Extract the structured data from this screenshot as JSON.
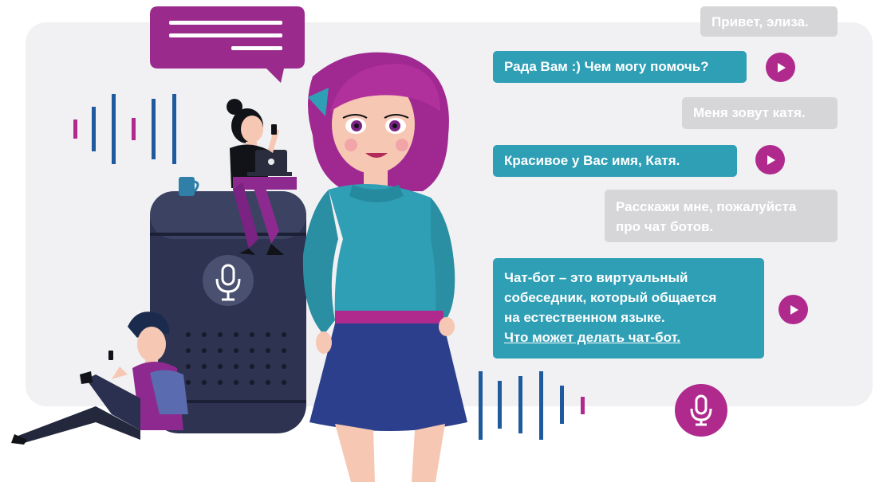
{
  "chat": {
    "messages": [
      {
        "role": "user",
        "lines": [
          "Привет, элиза."
        ]
      },
      {
        "role": "bot",
        "lines": [
          "Рада Вам :) Чем могу помочь?"
        ]
      },
      {
        "role": "user",
        "lines": [
          "Меня зовут катя."
        ]
      },
      {
        "role": "bot",
        "lines": [
          "Красивое у Вас имя, Катя."
        ]
      },
      {
        "role": "user",
        "lines": [
          "Расскажи мне, пожалуйста",
          "про чат ботов."
        ]
      },
      {
        "role": "bot",
        "lines": [
          "Чат-бот – это виртуальный",
          "собеседник, который общается",
          "на естественном языке."
        ],
        "link": "Что может делать чат-бот."
      }
    ]
  },
  "icons": {
    "play": "play-icon",
    "microphone": "microphone-icon",
    "speech_bubble": "speech-bubble-icon"
  },
  "colors": {
    "bot_bubble": "#2f9fb5",
    "user_bubble": "#d6d6d9",
    "accent": "#b02a8e",
    "speaker": "#2d3350",
    "wave_blue": "#1f5a9e"
  }
}
